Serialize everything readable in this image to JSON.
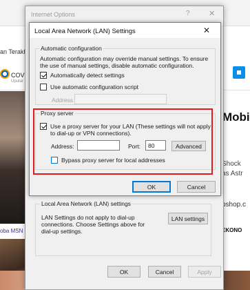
{
  "background_page": {
    "title_fragment": "an Terakh",
    "left_brand": "COV",
    "left_brand_sub": "Uputar",
    "right_headline": "Mobi",
    "right_line1": "Shock",
    "right_line2": "as Astr",
    "right_shop": "pshop.c",
    "right_teko": "EKONO",
    "left_msn": "oba MSN"
  },
  "internet_options": {
    "title": "Internet Options",
    "help_glyph": "?",
    "close_glyph": "✕",
    "lan_group": {
      "title": "Local Area Network (LAN) settings",
      "text": "LAN Settings do not apply to dial-up connections. Choose Settings above for dial-up settings.",
      "lan_settings_button": "LAN settings"
    },
    "buttons": {
      "ok": "OK",
      "cancel": "Cancel",
      "apply": "Apply"
    }
  },
  "lan_dialog": {
    "title": "Local Area Network (LAN) Settings",
    "close_glyph": "✕",
    "auto_config": {
      "title": "Automatic configuration",
      "description": "Automatic configuration may override manual settings.  To ensure the use of manual settings, disable automatic configuration.",
      "auto_detect": {
        "label": "Automatically detect settings",
        "checked": true
      },
      "use_script": {
        "label": "Use automatic configuration script",
        "checked": false
      },
      "address_label": "Address",
      "address_value": ""
    },
    "proxy": {
      "title": "Proxy server",
      "use_proxy": {
        "label": "Use a proxy server for your LAN (These settings will not apply to dial-up or VPN connections).",
        "checked": true
      },
      "address_label": "Address:",
      "address_value": "",
      "port_label": "Port:",
      "port_value": "80",
      "advanced_button": "Advanced",
      "bypass": {
        "label": "Bypass proxy server for local addresses",
        "checked": false
      }
    },
    "buttons": {
      "ok": "OK",
      "cancel": "Cancel"
    }
  },
  "colors": {
    "highlight_border": "#e01b1b",
    "focus_blue": "#0078d7",
    "dialog_bg": "#f0f0f0"
  }
}
